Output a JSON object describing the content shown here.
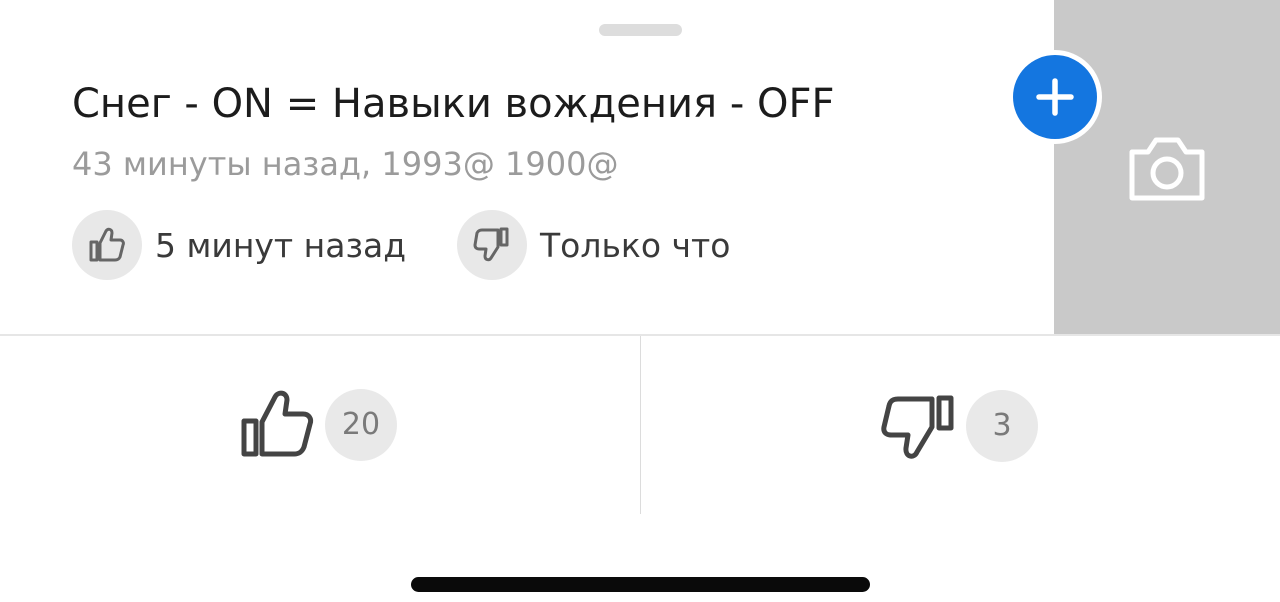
{
  "post": {
    "title": "Снег - ON = Навыки вождения - OFF",
    "meta": "43 минуты назад, 1993@ 1900@"
  },
  "reactions": {
    "like_time": "5 минут назад",
    "dislike_time": "Только что"
  },
  "votes": {
    "likes": "20",
    "dislikes": "3"
  },
  "colors": {
    "accent": "#1476e0",
    "photo_panel": "#c9c9c9",
    "badge": "#e9e9e9"
  },
  "icons": {
    "add": "plus-icon",
    "photo": "camera-icon",
    "like": "thumbs-up-icon",
    "dislike": "thumbs-down-icon"
  }
}
